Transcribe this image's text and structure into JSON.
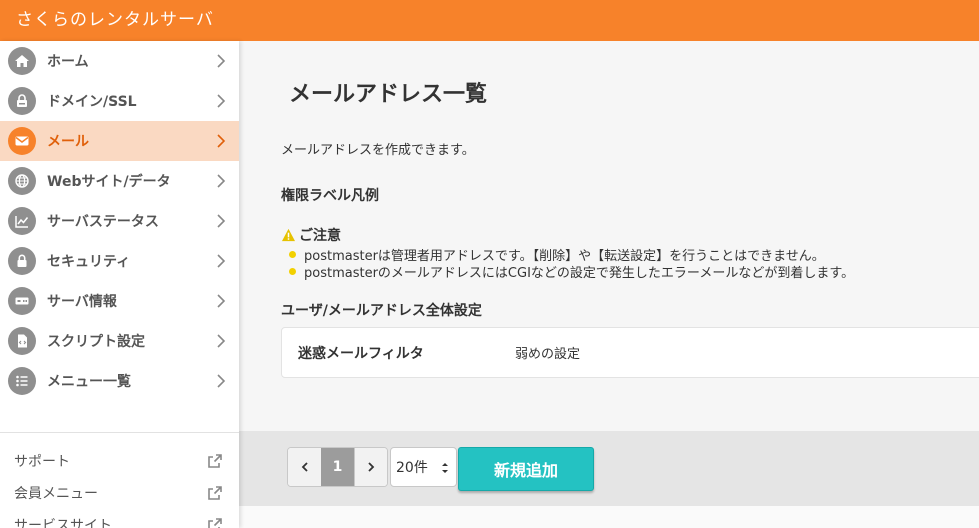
{
  "app": {
    "title": "さくらのレンタルサーバ"
  },
  "sidebar": {
    "items": [
      {
        "label": "ホーム",
        "icon": "home-icon",
        "active": false
      },
      {
        "label": "ドメイン/SSL",
        "icon": "domain-icon",
        "active": false
      },
      {
        "label": "メール",
        "icon": "mail-icon",
        "active": true
      },
      {
        "label": "Webサイト/データ",
        "icon": "globe-icon",
        "active": false
      },
      {
        "label": "サーバステータス",
        "icon": "chart-icon",
        "active": false
      },
      {
        "label": "セキュリティ",
        "icon": "lock-icon",
        "active": false
      },
      {
        "label": "サーバ情報",
        "icon": "server-icon",
        "active": false
      },
      {
        "label": "スクリプト設定",
        "icon": "script-icon",
        "active": false
      },
      {
        "label": "メニュー一覧",
        "icon": "list-icon",
        "active": false
      }
    ],
    "sub_items": [
      {
        "label": "サポート",
        "icon": "external-link-icon"
      },
      {
        "label": "会員メニュー",
        "icon": "external-link-icon"
      },
      {
        "label": "サービスサイト",
        "icon": "external-link-icon"
      }
    ]
  },
  "main": {
    "title": "メールアドレス一覧",
    "intro": "メールアドレスを作成できます。",
    "permission_legend": "権限ラベル凡例",
    "notice": {
      "title": "ご注意",
      "items": [
        "postmasterは管理者用アドレスです。【削除】や【転送設定】を行うことはできません。",
        "postmasterのメールアドレスにはCGIなどの設定で発生したエラーメールなどが到着します。"
      ]
    },
    "settings": {
      "title": "ユーザ/メールアドレス全体設定",
      "rows": [
        {
          "label": "迷惑メールフィルタ",
          "value": "弱めの設定"
        }
      ]
    }
  },
  "pagination": {
    "prev": "‹",
    "current_page": "1",
    "next": "›",
    "per_page": "20件"
  },
  "actions": {
    "add_label": "新規追加"
  },
  "colors": {
    "brand": "#f7822a",
    "active_bg": "#fad9c2",
    "primary_button": "#24c2c2",
    "notice_dot": "#f2d000"
  }
}
